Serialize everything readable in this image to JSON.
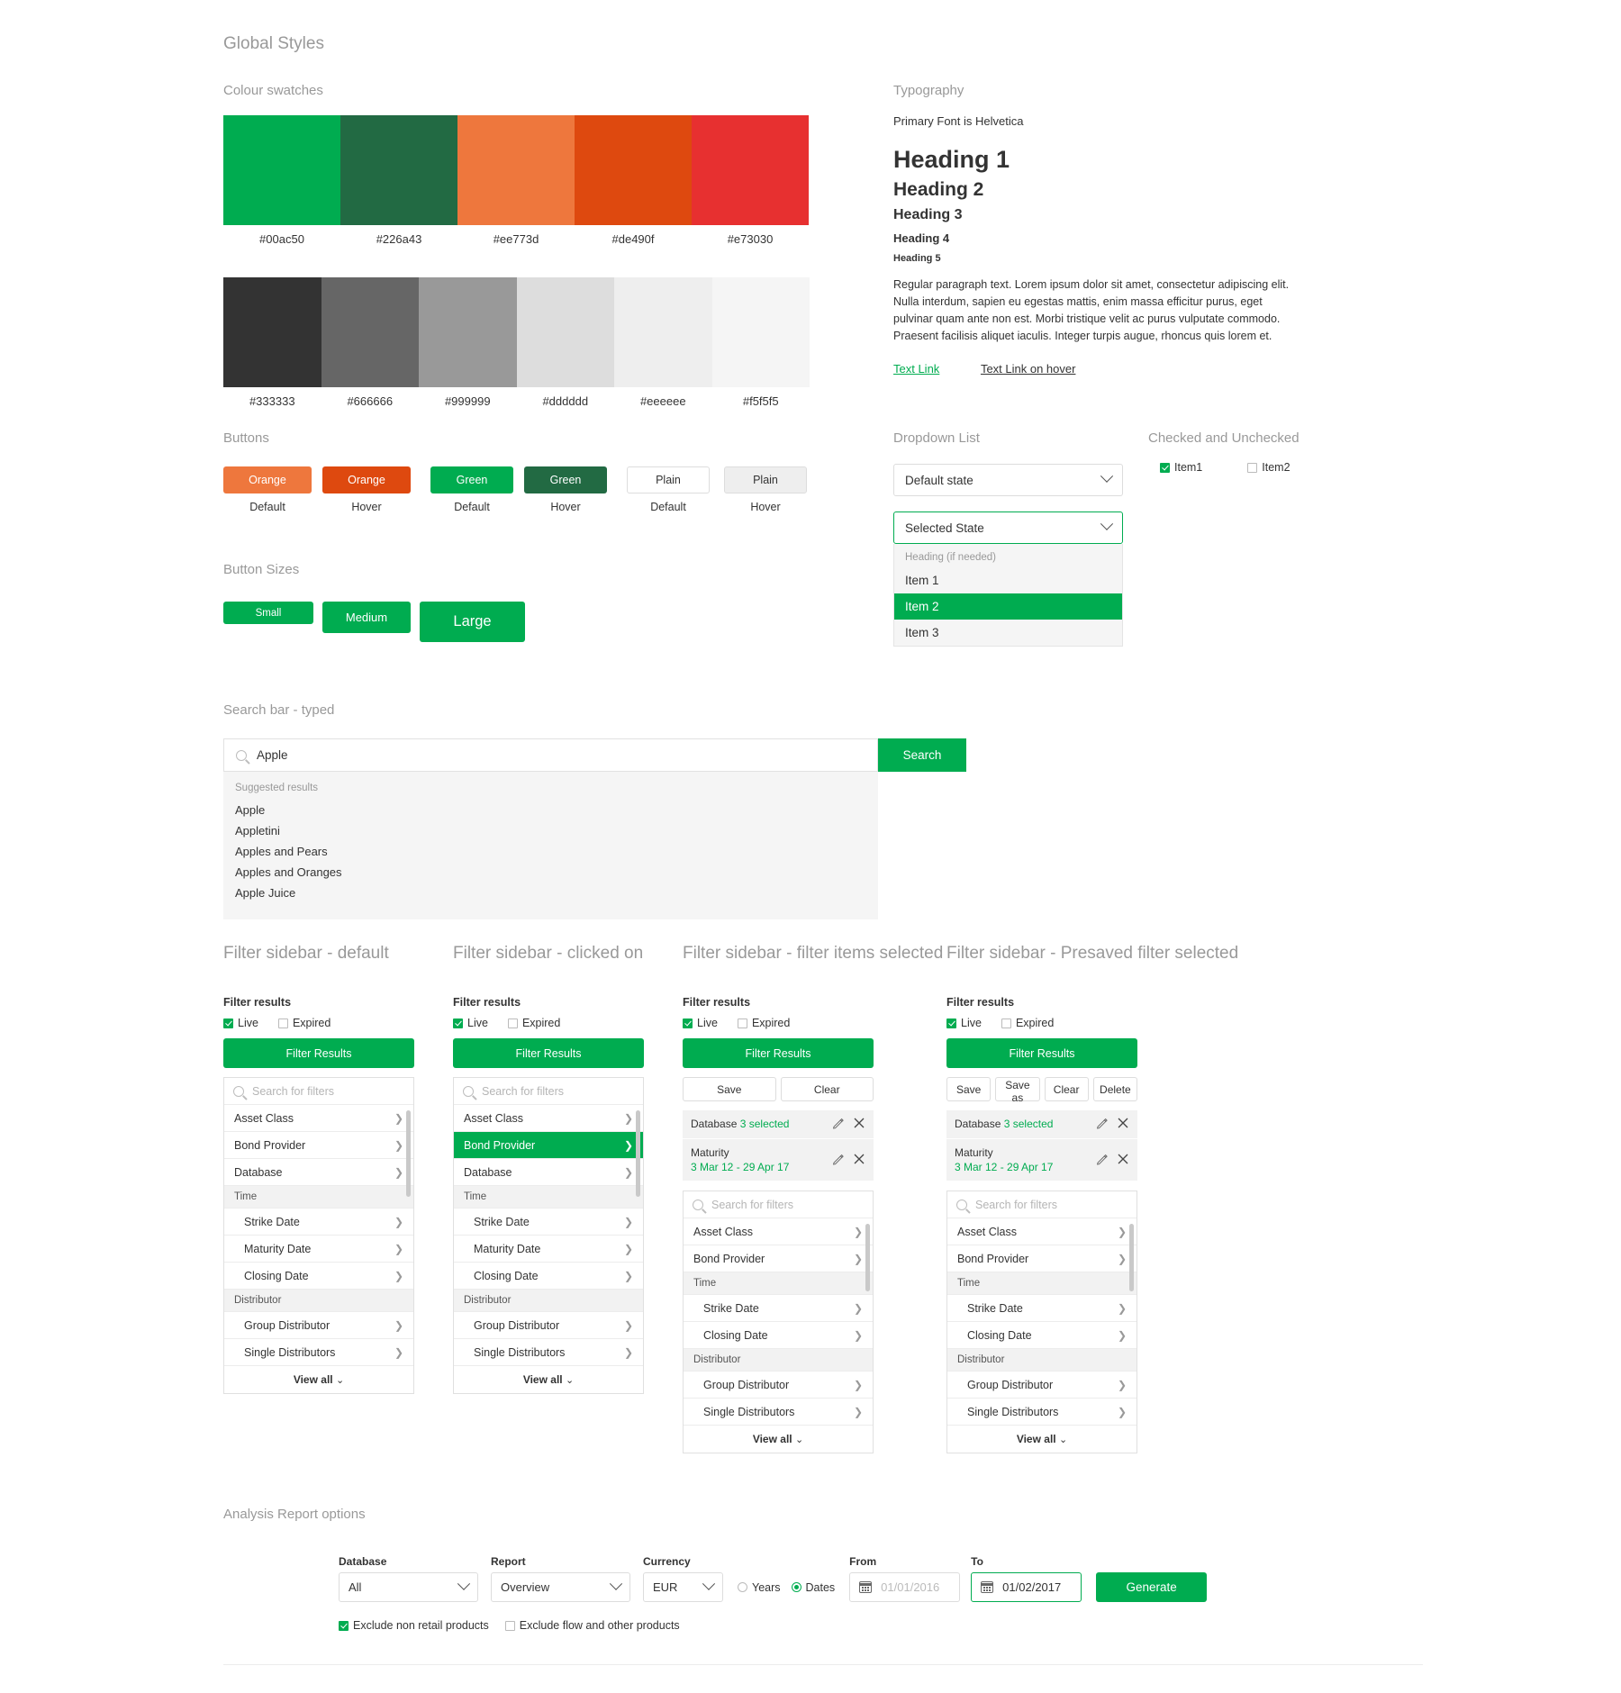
{
  "page_title": "Global Styles",
  "colour_swatches": {
    "heading": "Colour swatches",
    "brand": [
      {
        "hex": "#00ac50",
        "label": "#00ac50"
      },
      {
        "hex": "#226a43",
        "label": "#226a43"
      },
      {
        "hex": "#ee773d",
        "label": "#ee773d"
      },
      {
        "hex": "#de490f",
        "label": "#de490f"
      },
      {
        "hex": "#e73030",
        "label": "#e73030"
      }
    ],
    "greys": [
      {
        "hex": "#333333",
        "label": "#333333"
      },
      {
        "hex": "#666666",
        "label": "#666666"
      },
      {
        "hex": "#999999",
        "label": "#999999"
      },
      {
        "hex": "#dddddd",
        "label": "#dddddd"
      },
      {
        "hex": "#eeeeee",
        "label": "#eeeeee"
      },
      {
        "hex": "#f5f5f5",
        "label": "#f5f5f5"
      }
    ]
  },
  "typography": {
    "heading": "Typography",
    "primary_font_note": "Primary Font is Helvetica",
    "h1": "Heading 1",
    "h2": "Heading 2",
    "h3": "Heading 3",
    "h4": "Heading 4",
    "h5": "Heading 5",
    "paragraph": "Regular paragraph text. Lorem ipsum dolor sit amet, consectetur adipiscing elit. Nulla interdum, sapien eu egestas mattis, enim massa efficitur purus, eget pulvinar quam ante non est. Morbi tristique velit ac purus vulputate commodo. Praesent facilisis aliquet iaculis. Integer turpis augue, rhoncus quis lorem et.",
    "link_default": "Text Link",
    "link_hover": "Text Link on hover"
  },
  "buttons": {
    "heading": "Buttons",
    "items": [
      {
        "label": "Orange",
        "state": "Default"
      },
      {
        "label": "Orange",
        "state": "Hover"
      },
      {
        "label": "Green",
        "state": "Default"
      },
      {
        "label": "Green",
        "state": "Hover"
      },
      {
        "label": "Plain",
        "state": "Default"
      },
      {
        "label": "Plain",
        "state": "Hover"
      }
    ]
  },
  "button_sizes": {
    "heading": "Button Sizes",
    "small": "Small",
    "medium": "Medium",
    "large": "Large"
  },
  "dropdown": {
    "heading": "Dropdown List",
    "default_state": "Default state",
    "selected_state": "Selected State",
    "list_heading": "Heading (if needed)",
    "item1": "Item 1",
    "item2": "Item 2",
    "item3": "Item 3"
  },
  "checkboxes": {
    "heading": "Checked and Unchecked",
    "item1": "Item1",
    "item2": "Item2"
  },
  "search": {
    "heading": "Search bar - typed",
    "value": "Apple",
    "button": "Search",
    "suggested_heading": "Suggested results",
    "suggestions": [
      "Apple",
      "Appletini",
      "Apples and Pears",
      "Apples and Oranges",
      "Apple Juice"
    ]
  },
  "sidebars": [
    {
      "heading": "Filter sidebar - default",
      "filter_results_label": "Filter results",
      "live_label": "Live",
      "expired_label": "Expired",
      "filter_button": "Filter Results",
      "search_placeholder": "Search for filters",
      "view_all": "View all",
      "actions": [],
      "chips": [],
      "items": [
        {
          "label": "Asset Class",
          "type": "item"
        },
        {
          "label": "Bond Provider",
          "type": "item"
        },
        {
          "label": "Database",
          "type": "item"
        },
        {
          "label": "Time",
          "type": "group"
        },
        {
          "label": "Strike Date",
          "type": "sub"
        },
        {
          "label": "Maturity Date",
          "type": "sub"
        },
        {
          "label": "Closing Date",
          "type": "sub"
        },
        {
          "label": "Distributor",
          "type": "group"
        },
        {
          "label": "Group Distributor",
          "type": "sub"
        },
        {
          "label": "Single Distributors",
          "type": "sub"
        }
      ]
    },
    {
      "heading": "Filter sidebar - clicked on",
      "filter_results_label": "Filter results",
      "live_label": "Live",
      "expired_label": "Expired",
      "filter_button": "Filter Results",
      "search_placeholder": "Search for filters",
      "view_all": "View all",
      "actions": [],
      "chips": [],
      "items": [
        {
          "label": "Asset Class",
          "type": "item"
        },
        {
          "label": "Bond Provider",
          "type": "item",
          "selected": true
        },
        {
          "label": "Database",
          "type": "item"
        },
        {
          "label": "Time",
          "type": "group"
        },
        {
          "label": "Strike Date",
          "type": "sub"
        },
        {
          "label": "Maturity Date",
          "type": "sub"
        },
        {
          "label": "Closing Date",
          "type": "sub"
        },
        {
          "label": "Distributor",
          "type": "group"
        },
        {
          "label": "Group Distributor",
          "type": "sub"
        },
        {
          "label": "Single Distributors",
          "type": "sub"
        }
      ]
    },
    {
      "heading": "Filter sidebar - filter items selected",
      "filter_results_label": "Filter results",
      "live_label": "Live",
      "expired_label": "Expired",
      "filter_button": "Filter Results",
      "search_placeholder": "Search for filters",
      "view_all": "View all",
      "actions": [
        "Save",
        "Clear"
      ],
      "chips": [
        {
          "name": "Database",
          "value": "3 selected",
          "inline": true
        },
        {
          "name": "Maturity",
          "value": "3 Mar 12 - 29 Apr 17",
          "inline": false
        }
      ],
      "items": [
        {
          "label": "Asset Class",
          "type": "item"
        },
        {
          "label": "Bond Provider",
          "type": "item"
        },
        {
          "label": "Time",
          "type": "group"
        },
        {
          "label": "Strike Date",
          "type": "sub"
        },
        {
          "label": "Closing Date",
          "type": "sub"
        },
        {
          "label": "Distributor",
          "type": "group"
        },
        {
          "label": "Group Distributor",
          "type": "sub"
        },
        {
          "label": "Single Distributors",
          "type": "sub"
        }
      ]
    },
    {
      "heading": "Filter sidebar - Presaved filter selected",
      "filter_results_label": "Filter results",
      "live_label": "Live",
      "expired_label": "Expired",
      "filter_button": "Filter Results",
      "search_placeholder": "Search for filters",
      "view_all": "View all",
      "actions": [
        "Save",
        "Save as",
        "Clear",
        "Delete"
      ],
      "chips": [
        {
          "name": "Database",
          "value": "3 selected",
          "inline": true
        },
        {
          "name": "Maturity",
          "value": "3 Mar 12 - 29 Apr 17",
          "inline": false
        }
      ],
      "items": [
        {
          "label": "Asset Class",
          "type": "item"
        },
        {
          "label": "Bond Provider",
          "type": "item"
        },
        {
          "label": "Time",
          "type": "group"
        },
        {
          "label": "Strike Date",
          "type": "sub"
        },
        {
          "label": "Closing Date",
          "type": "sub"
        },
        {
          "label": "Distributor",
          "type": "group"
        },
        {
          "label": "Group Distributor",
          "type": "sub"
        },
        {
          "label": "Single Distributors",
          "type": "sub"
        }
      ]
    }
  ],
  "analysis_report": {
    "heading": "Analysis Report options",
    "database_label": "Database",
    "database_value": "All",
    "report_label": "Report",
    "report_value": "Overview",
    "currency_label": "Currency",
    "currency_value": "EUR",
    "years_label": "Years",
    "dates_label": "Dates",
    "from_label": "From",
    "from_value": "01/01/2016",
    "to_label": "To",
    "to_value": "01/02/2017",
    "generate_label": "Generate",
    "exclude_non_retail": "Exclude non retail products",
    "exclude_flow": "Exclude flow and other products"
  }
}
